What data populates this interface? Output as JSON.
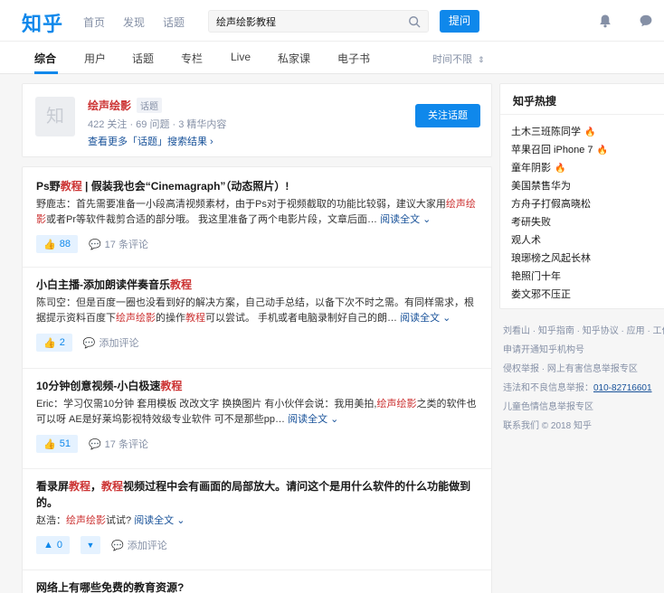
{
  "header": {
    "logo": "知乎",
    "nav": [
      "首页",
      "发现",
      "话题"
    ],
    "search_value": "绘声绘影教程",
    "ask_label": "提问"
  },
  "tabs": {
    "items": [
      "综合",
      "用户",
      "话题",
      "专栏",
      "Live",
      "私家课",
      "电子书"
    ],
    "active": "综合",
    "time_filter": "时间不限"
  },
  "topic": {
    "avatar_text": "知",
    "name": "绘声绘影",
    "tag": "话题",
    "stats": "422 关注 · 69 问题 · 3 精华内容",
    "more": "查看更多「话题」搜索结果 ›",
    "follow_label": "关注话题"
  },
  "results": [
    {
      "title_pre": "Ps野",
      "title_hl": "教程",
      "title_post": " | 假装我也会“Cinemagraph”（动态照片）!",
      "excerpt_pre": "野鹿志：首先需要准备一小段高清视频素材，由于Ps对于视频截取的功能比较弱，建议大家用",
      "excerpt_hl": "绘声绘影",
      "excerpt_post": "或者Pr等软件裁剪合适的部分哦。 我这里准备了两个电影片段，文章后面…",
      "read_more": "阅读全文 ⌄",
      "votes": "88",
      "comments": "17 条评论"
    },
    {
      "title_pre": "小白主播-添加朗读伴奏音乐",
      "title_hl": "教程",
      "title_post": "",
      "excerpt_pre": "陈司空：但是百度一圈也没看到好的解决方案，自己动手总结，以备下次不时之需。有同样需求，根据提示资料百度下",
      "excerpt_hl": "绘声绘影",
      "excerpt_mid": "的操作",
      "excerpt_hl2": "教程",
      "excerpt_post": "可以尝试。 手机或者电脑录制好自己的朗…",
      "read_more": "阅读全文 ⌄",
      "votes": "2",
      "comments": "添加评论"
    },
    {
      "title_pre": "10分钟创意视频-小白极速",
      "title_hl": "教程",
      "title_post": "",
      "excerpt_pre": "Eric：学习仅需10分钟 套用模板 改改文字 换换图片 有小伙伴会说：我用美拍,",
      "excerpt_hl": "绘声绘影",
      "excerpt_post": "之类的软件也可以呀 AE是好莱坞影视特效级专业软件 可不是那些pp…",
      "read_more": "阅读全文 ⌄",
      "votes": "51",
      "comments": "17 条评论"
    },
    {
      "title_pre": "看录屏",
      "title_hl": "教程",
      "title_mid": "，",
      "title_hl2": "教程",
      "title_post": "视频过程中会有画面的局部放大。请问这个是用什么软件的什么功能做到的。",
      "excerpt_pre": "赵浩：",
      "excerpt_hl": "绘声绘影",
      "excerpt_post": "试试?",
      "read_more": "阅读全文 ⌄",
      "votes": "0",
      "comments": "添加评论"
    },
    {
      "title_pre": "网络上有哪些免费的教育资源?"
    }
  ],
  "hot": {
    "title": "知乎热搜",
    "items": [
      {
        "label": "土木三班陈同学",
        "fire": true
      },
      {
        "label": "苹果召回 iPhone 7",
        "fire": true
      },
      {
        "label": "童年阴影",
        "fire": true
      },
      {
        "label": "美国禁售华为",
        "fire": false
      },
      {
        "label": "方舟子打假高晓松",
        "fire": false
      },
      {
        "label": "考研失败",
        "fire": false
      },
      {
        "label": "观人术",
        "fire": false
      },
      {
        "label": "琅琊榜之风起长林",
        "fire": false
      },
      {
        "label": "艳照门十年",
        "fire": false
      },
      {
        "label": "娄文邪不压正",
        "fire": false
      }
    ]
  },
  "footer": {
    "line1": "刘看山 · 知乎指南 · 知乎协议 · 应用 · 工作",
    "line2": "申请开通知乎机构号",
    "line3": "侵权举报 · 网上有害信息举报专区",
    "line4_pre": "违法和不良信息举报：",
    "line4_phone": "010-82716601",
    "line5": "儿童色情信息举报专区",
    "line6": "联系我们 © 2018 知乎"
  },
  "colors": {
    "brand": "#0f88eb",
    "highlight": "#cc3333",
    "link": "#175199",
    "hot_fire": "#f1403c"
  }
}
